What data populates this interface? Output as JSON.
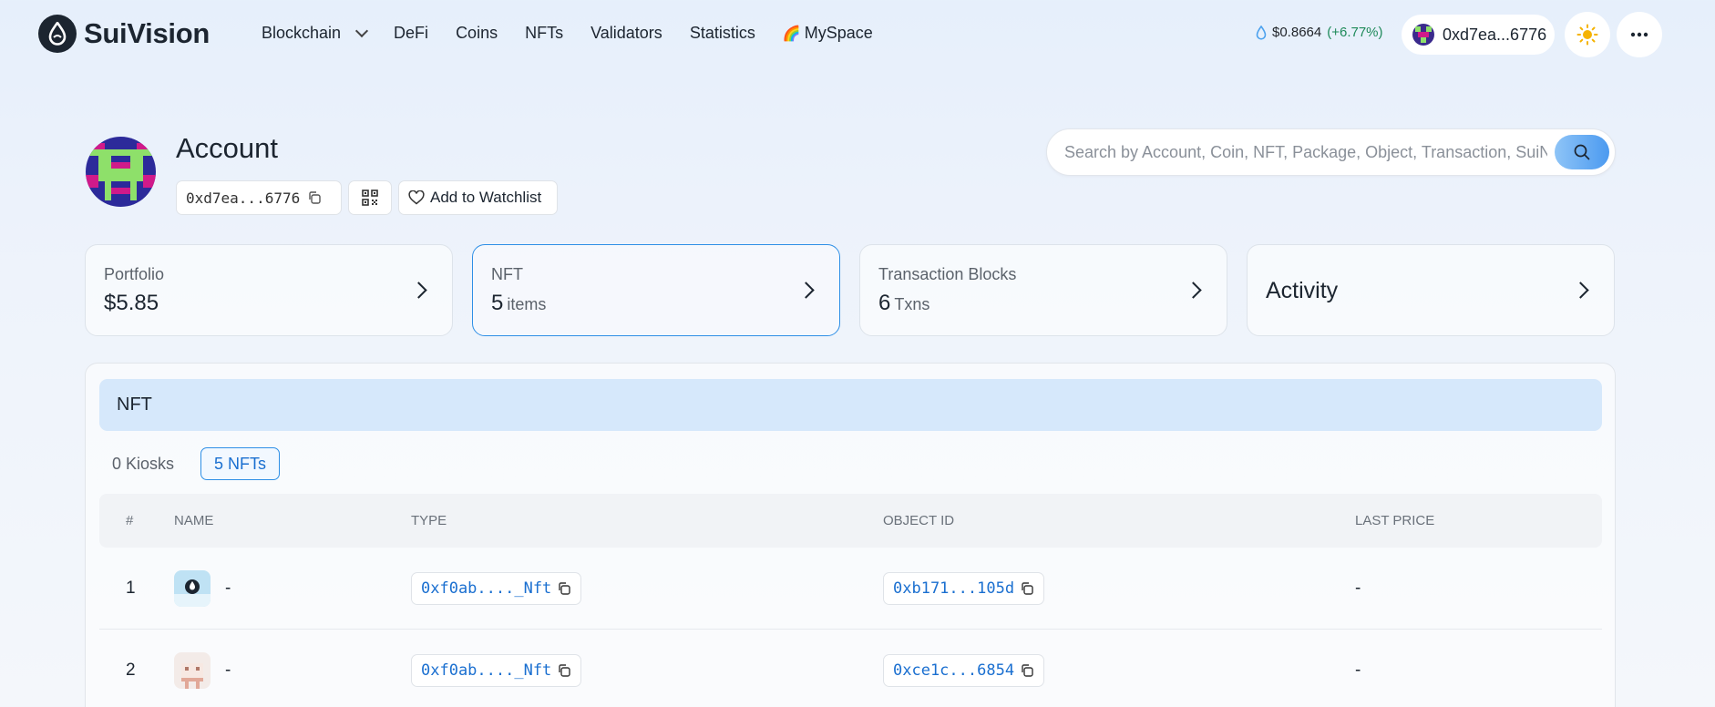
{
  "brand": {
    "name": "SuiVision"
  },
  "nav": {
    "items": [
      {
        "label": "Blockchain",
        "has_dropdown": true
      },
      {
        "label": "DeFi"
      },
      {
        "label": "Coins"
      },
      {
        "label": "NFTs"
      },
      {
        "label": "Validators"
      },
      {
        "label": "Statistics"
      },
      {
        "label": "MySpace",
        "emoji": "🌈"
      }
    ]
  },
  "ticker": {
    "price": "$0.8664",
    "change": "(+6.77%)",
    "change_color": "#1e8a5a"
  },
  "wallet": {
    "address": "0xd7ea...6776"
  },
  "account": {
    "title": "Account",
    "address": "0xd7ea...6776",
    "watchlist_label": "Add to Watchlist"
  },
  "search": {
    "placeholder": "Search by Account, Coin, NFT, Package, Object, Transaction, SuiNS"
  },
  "cards": [
    {
      "label": "Portfolio",
      "value": "$5.85",
      "unit": ""
    },
    {
      "label": "NFT",
      "value": "5",
      "unit": "items",
      "active": true
    },
    {
      "label": "Transaction Blocks",
      "value": "6",
      "unit": "Txns"
    },
    {
      "label": "Activity"
    }
  ],
  "nft_panel": {
    "title": "NFT",
    "tabs": [
      {
        "label": "0 Kiosks"
      },
      {
        "label": "5 NFTs",
        "active": true
      }
    ],
    "columns": [
      "#",
      "NAME",
      "TYPE",
      "OBJECT ID",
      "LAST PRICE"
    ],
    "rows": [
      {
        "index": "1",
        "name": "-",
        "type": "0xf0ab...._Nft",
        "object_id": "0xb171...105d",
        "last_price": "-"
      },
      {
        "index": "2",
        "name": "-",
        "type": "0xf0ab...._Nft",
        "object_id": "0xce1c...6854",
        "last_price": "-"
      }
    ]
  },
  "colors": {
    "accent": "#2e8fe6",
    "link": "#1a6fd0",
    "panel_head": "#d6e8fb"
  }
}
